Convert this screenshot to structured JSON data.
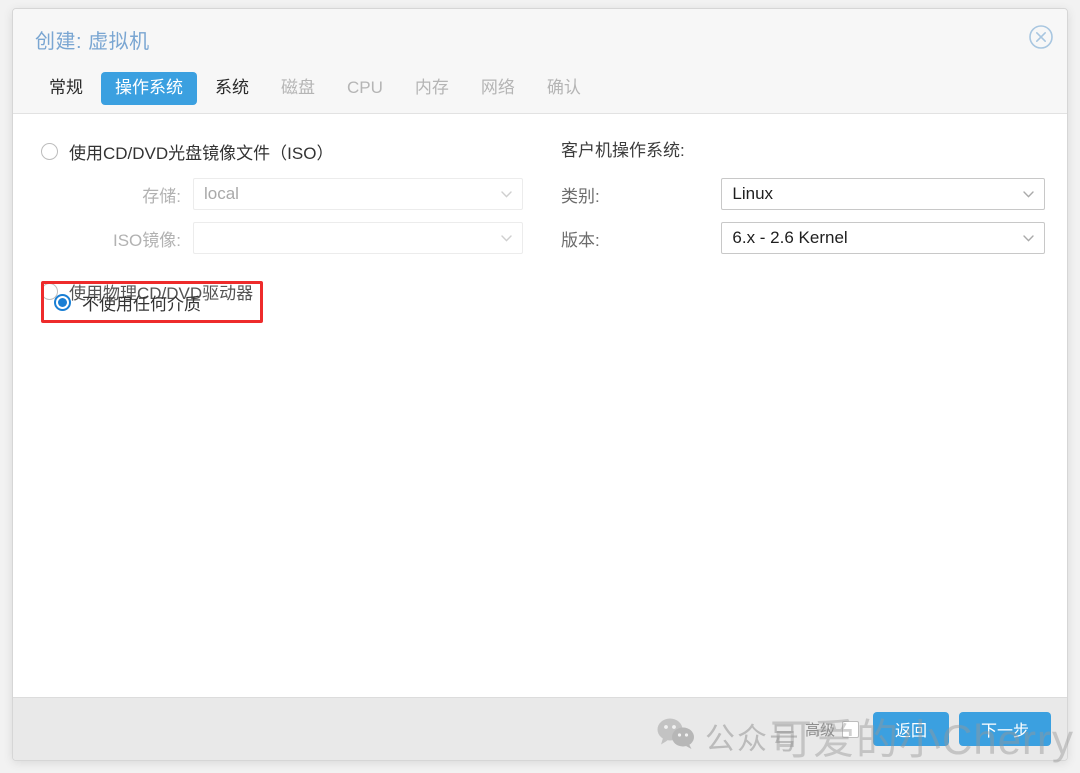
{
  "window": {
    "title": "创建: 虚拟机",
    "close_icon": "close-circle-icon"
  },
  "tabs": [
    {
      "label": "常规",
      "state": "enabled"
    },
    {
      "label": "操作系统",
      "state": "active"
    },
    {
      "label": "系统",
      "state": "enabled"
    },
    {
      "label": "磁盘",
      "state": "disabled"
    },
    {
      "label": "CPU",
      "state": "disabled"
    },
    {
      "label": "内存",
      "state": "disabled"
    },
    {
      "label": "网络",
      "state": "disabled"
    },
    {
      "label": "确认",
      "state": "disabled"
    }
  ],
  "media": {
    "option_iso": "使用CD/DVD光盘镜像文件（ISO）",
    "option_physical": "使用物理CD/DVD驱动器",
    "option_none": "不使用任何介质",
    "selected": "不使用任何介质",
    "storage_label": "存储:",
    "storage_value": "local",
    "iso_label": "ISO镜像:",
    "iso_value": "",
    "iso_placeholder": ""
  },
  "guest_os": {
    "section_title": "客户机操作系统:",
    "type_label": "类别:",
    "type_value": "Linux",
    "version_label": "版本:",
    "version_value": "6.x - 2.6 Kernel"
  },
  "footer": {
    "advanced_label": "高级",
    "advanced_checked": false,
    "back_button": "返回",
    "next_button": "下一步"
  },
  "watermark": {
    "wechat_icon": "wechat-icon",
    "wechat_text": "公众号",
    "big_text": "可爱的小Cherry"
  },
  "colors": {
    "accent": "#3ba0e0",
    "title": "#7aa6d2",
    "highlight": "#ee2b2b",
    "radio_selected": "#1a7fd4",
    "footer_bg": "#e9e9e9"
  }
}
